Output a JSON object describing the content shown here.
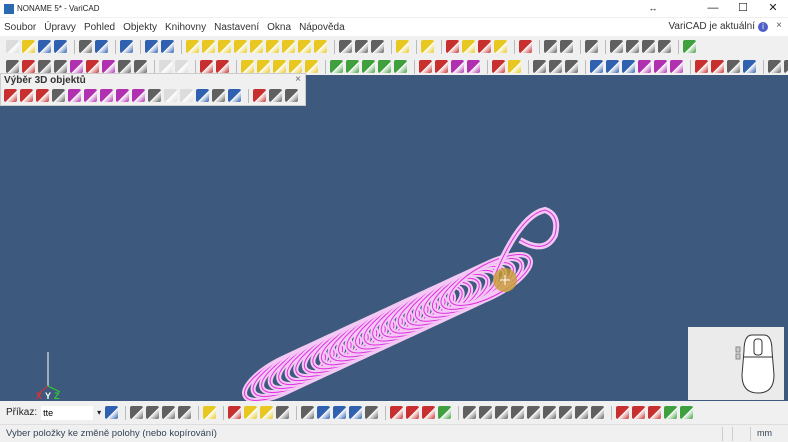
{
  "window": {
    "title": "NONAME 5* - VariCAD",
    "minimize": "—",
    "maximize": "☐",
    "close": "✕",
    "resize": "↔"
  },
  "menu": {
    "items": [
      "Soubor",
      "Úpravy",
      "Pohled",
      "Objekty",
      "Knihovny",
      "Nastavení",
      "Okna",
      "Nápověda"
    ],
    "update_text": "VariCAD je aktuální",
    "info": "i",
    "update_close": "×"
  },
  "panel": {
    "title": "Výběr 3D objektů",
    "close": "×"
  },
  "command": {
    "label": "Příkaz:",
    "value": "tte"
  },
  "status": {
    "text": "Vyber položky ke změně polohy (nebo kopírování)",
    "units": "mm"
  },
  "axes": {
    "x": "X",
    "y": "Y",
    "z": "Z"
  },
  "colors": {
    "canvas": "#3d5a7e",
    "spring": "#e030e0",
    "spring_light": "#f4c8f4",
    "accent": "#5060c8"
  }
}
